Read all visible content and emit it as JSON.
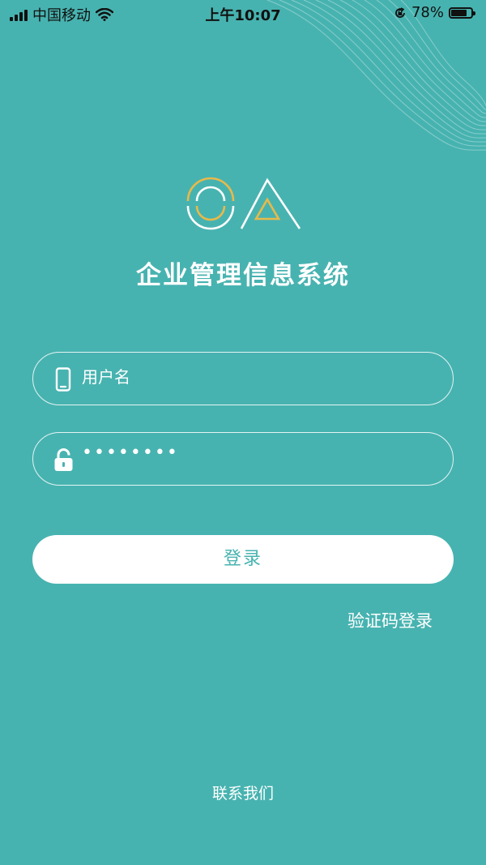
{
  "status_bar": {
    "carrier": "中国移动",
    "time": "上午10:07",
    "battery_text": "78%",
    "battery_level": 0.78,
    "icons": [
      "signal-icon",
      "wifi-icon",
      "orientation-lock-icon",
      "battery-icon"
    ]
  },
  "app": {
    "title": "企业管理信息系统"
  },
  "login_form": {
    "username_placeholder": "用户名",
    "password_value": "••••••••",
    "login_label": "登录",
    "sms_login_label": "验证码登录"
  },
  "footer": {
    "contact_label": "联系我们"
  },
  "colors": {
    "background": "#47b3b0",
    "logo_gold": "#e8b94a",
    "text": "#ffffff"
  }
}
